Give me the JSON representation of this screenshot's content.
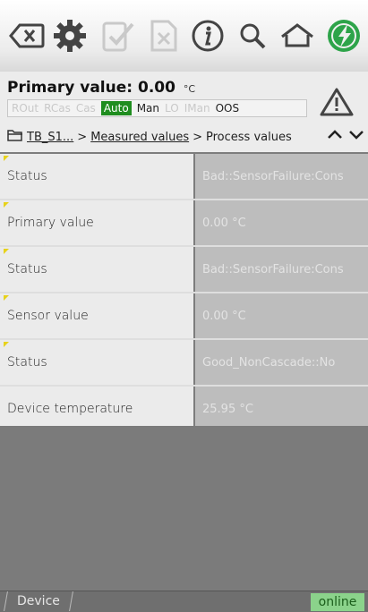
{
  "toolbar": {
    "icons": [
      "backspace-icon",
      "gear-icon",
      "check-icon",
      "cancel-icon",
      "info-icon",
      "search-icon",
      "home-icon",
      "power-icon"
    ]
  },
  "header": {
    "primary_label": "Primary value:",
    "primary_value": "0.00",
    "primary_unit": "°C",
    "modes": [
      {
        "label": "ROut",
        "state": "inactive"
      },
      {
        "label": "RCas",
        "state": "inactive"
      },
      {
        "label": "Cas",
        "state": "inactive"
      },
      {
        "label": "Auto",
        "state": "active"
      },
      {
        "label": "Man",
        "state": "on"
      },
      {
        "label": "LO",
        "state": "inactive"
      },
      {
        "label": "IMan",
        "state": "inactive"
      },
      {
        "label": "OOS",
        "state": "on"
      }
    ],
    "breadcrumb": {
      "item1": "TB_S1...",
      "sep1": ">",
      "item2": "Measured values",
      "sep2": ">",
      "item3": "Process values"
    }
  },
  "rows": [
    {
      "label": "Status",
      "value": "Bad::SensorFailure:Cons"
    },
    {
      "label": "Primary value",
      "value": "0.00 °C"
    },
    {
      "label": "Status",
      "value": "Bad::SensorFailure:Cons"
    },
    {
      "label": "Sensor value",
      "value": "0.00 °C"
    },
    {
      "label": "Status",
      "value": "Good_NonCascade::No"
    },
    {
      "label": "Device temperature",
      "value": "25.95 °C"
    }
  ],
  "footer": {
    "tab_label": "Device",
    "status": "online"
  },
  "colors": {
    "auto_active": "#1f8d1f",
    "power_green": "#2ea44a",
    "online_bg": "#8bd38b"
  }
}
